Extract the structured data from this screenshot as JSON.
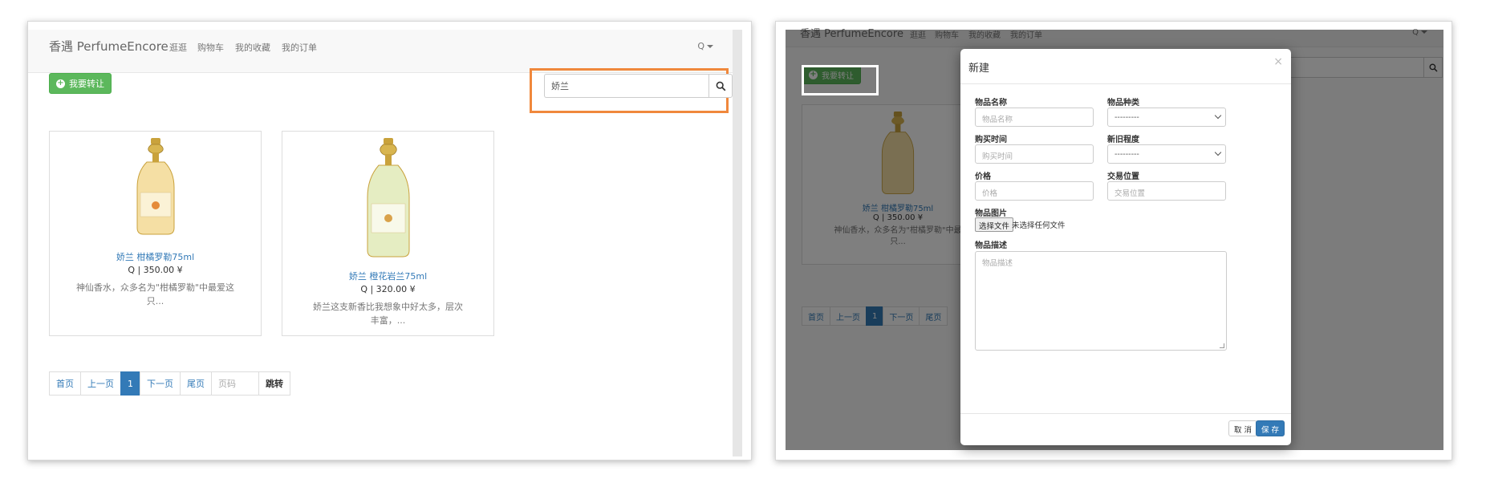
{
  "left": {
    "nav": {
      "brand": "香遇 PerfumeEncore",
      "items": [
        "逛逛",
        "购物车",
        "我的收藏",
        "我的订单"
      ],
      "user": "Q"
    },
    "sell_button": "我要转让",
    "search": {
      "value": "娇兰"
    },
    "products": [
      {
        "name": "娇兰 柑橘罗勒75ml",
        "price": "Q | 350.00 ¥",
        "desc_line1": "神仙香水，众多名为\"柑橘罗勒\"中最爱这",
        "desc_line2": "只..."
      },
      {
        "name": "娇兰 橙花岩兰75ml",
        "price": "Q | 320.00 ¥",
        "desc_line1": "娇兰这支新香比我想象中好太多，层次",
        "desc_line2": "丰富，..."
      }
    ],
    "pagination": {
      "first": "首页",
      "prev": "上一页",
      "current": "1",
      "next": "下一页",
      "last": "尾页",
      "page_input_placeholder": "页码",
      "go": "跳转"
    }
  },
  "right": {
    "background": {
      "brand": "香遇 PerfumeEncore",
      "nav_items": [
        "逛逛",
        "购物车",
        "我的收藏",
        "我的订单"
      ],
      "user": "Q",
      "sell_button": "我要转让",
      "product": {
        "name": "娇兰 柑橘罗勒75ml",
        "price": "Q | 350.00 ¥",
        "desc_line1": "神仙香水，众多名为\"柑橘罗勒\"中最",
        "desc_line2": "只..."
      },
      "pagination": [
        "首页",
        "上一页",
        "1",
        "下一页",
        "尾页"
      ]
    },
    "modal": {
      "title": "新建",
      "close": "×",
      "fields": {
        "name_label": "物品名称",
        "name_placeholder": "物品名称",
        "category_label": "物品种类",
        "category_value": "---------",
        "purchase_time_label": "购买时间",
        "purchase_time_placeholder": "购买时间",
        "condition_label": "新旧程度",
        "condition_value": "---------",
        "price_label": "价格",
        "price_placeholder": "价格",
        "location_label": "交易位置",
        "location_placeholder": "交易位置",
        "image_label": "物品图片",
        "file_button": "选择文件",
        "file_status": "未选择任何文件",
        "description_label": "物品描述",
        "description_placeholder": "物品描述"
      },
      "cancel": "取 消",
      "save": "保 存"
    }
  },
  "colors": {
    "success": "#5cb85c",
    "primary": "#337ab7",
    "highlight_orange": "#f0883c",
    "highlight_white": "#ffffff"
  }
}
